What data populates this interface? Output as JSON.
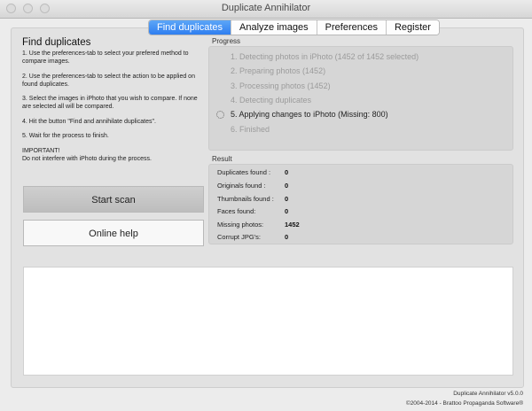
{
  "window": {
    "title": "Duplicate Annihilator"
  },
  "tabs": [
    {
      "label": "Find duplicates",
      "active": true
    },
    {
      "label": "Analyze images",
      "active": false
    },
    {
      "label": "Preferences",
      "active": false
    },
    {
      "label": "Register",
      "active": false
    }
  ],
  "instructions": {
    "title": "Find duplicates",
    "steps": [
      "1. Use the preferences-tab to select your prefered method to compare images.",
      "2. Use the preferences-tab to select the action to be applied on found duplicates.",
      "3. Select the images in iPhoto that you wish to compare. If none are selected all will be compared.",
      "4. Hit the button \"Find and annihilate duplicates\".",
      "5. Wait for the process to finish."
    ],
    "important_heading": "IMPORTANT!",
    "important_text": "Do not interfere with iPhoto during the process."
  },
  "buttons": {
    "start": "Start scan",
    "help": "Online help"
  },
  "progress": {
    "label": "Progress",
    "items": [
      {
        "text": "1. Detecting photos in iPhoto (1452 of 1452 selected)",
        "state": "done"
      },
      {
        "text": "2. Preparing photos (1452)",
        "state": "done"
      },
      {
        "text": "3. Processing photos (1452)",
        "state": "done"
      },
      {
        "text": "4. Detecting duplicates",
        "state": "done"
      },
      {
        "text": "5. Applying changes to iPhoto (Missing: 800)",
        "state": "current"
      },
      {
        "text": "6. Finished",
        "state": "pending"
      }
    ]
  },
  "result": {
    "label": "Result",
    "rows": [
      {
        "label": "Duplicates found :",
        "value": "0"
      },
      {
        "label": "Originals found :",
        "value": "0"
      },
      {
        "label": "Thumbnails found :",
        "value": "0"
      },
      {
        "label": "Faces found:",
        "value": "0"
      },
      {
        "label": "Missing photos:",
        "value": "1452"
      },
      {
        "label": "Corrupt JPG's:",
        "value": "0"
      }
    ]
  },
  "footer": {
    "version": "Duplicate Annihilator v5.0.0",
    "copyright": "©2004-2014 - Brattoo Propaganda Software®"
  }
}
